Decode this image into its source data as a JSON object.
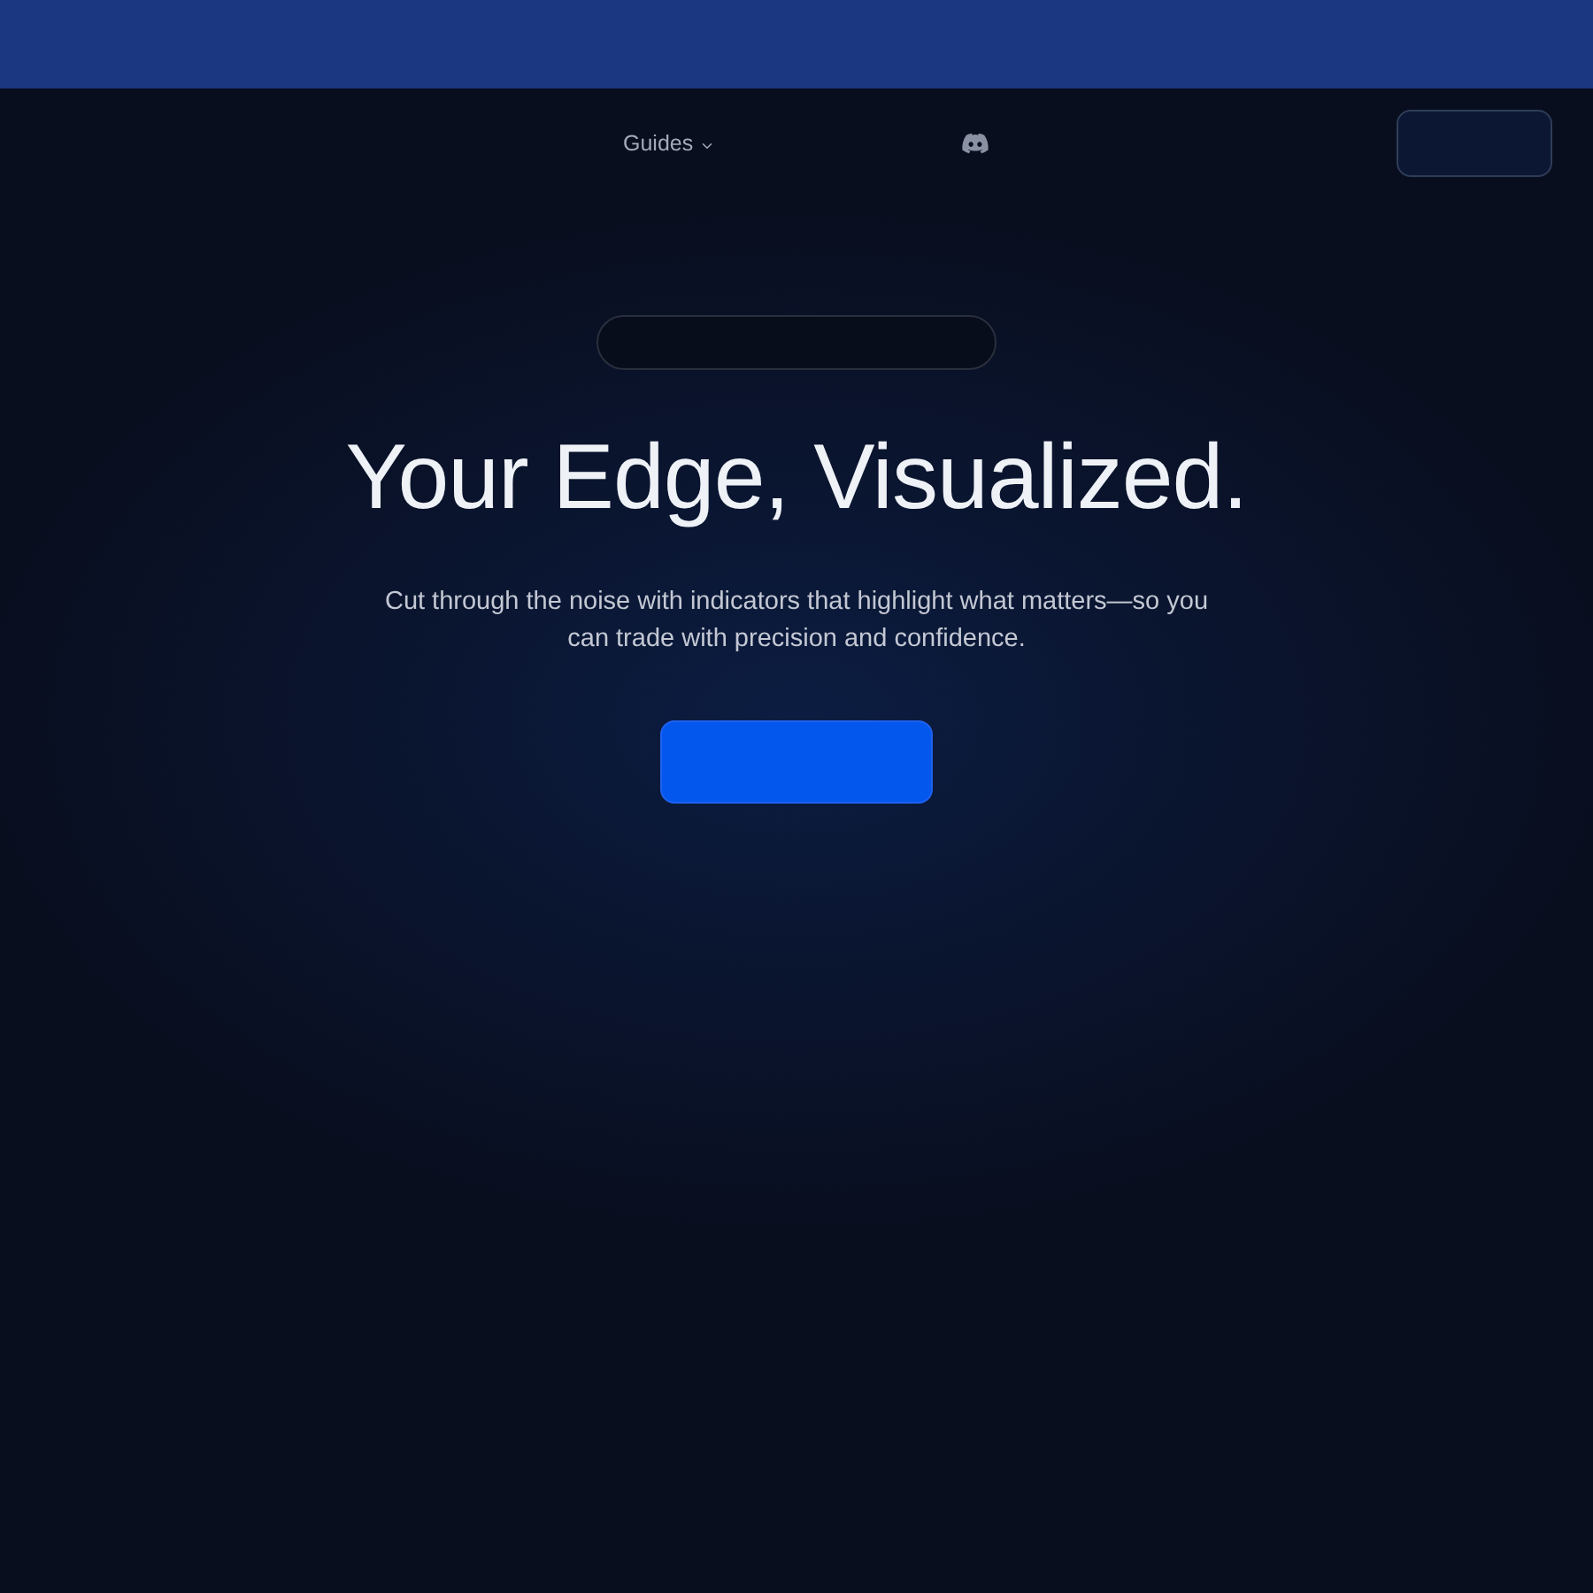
{
  "nav": {
    "items": [
      {
        "kind": "dropdown",
        "label": "Guides"
      },
      {
        "kind": "icon"
      }
    ]
  },
  "hero": {
    "title": "Your Edge, Visualized.",
    "subtitle": "Cut through the noise with indicators that highlight what matters—so you can trade with precision and confidence."
  }
}
